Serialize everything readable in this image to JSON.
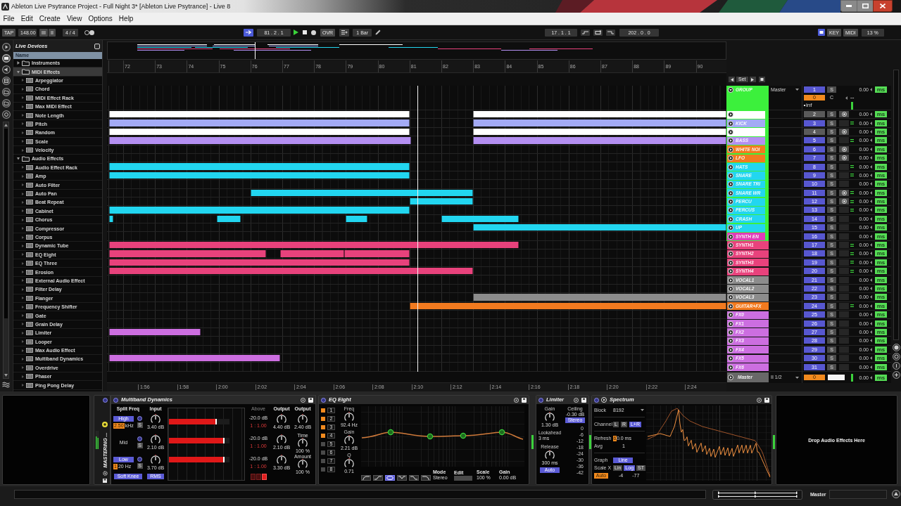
{
  "window": {
    "title": "Ableton Live Psytrance Project - Full Night 3*  [Ableton Live Psytrance] - Live 8"
  },
  "menu": [
    "File",
    "Edit",
    "Create",
    "View",
    "Options",
    "Help"
  ],
  "transport": {
    "tap": "TAP",
    "tempo": "148.00",
    "nudge_down": "III",
    "nudge_up": "II",
    "signature": "4 / 4",
    "follow": true,
    "position": "81 . 2 . 1",
    "playing": true,
    "recording": false,
    "overdub": "OVR",
    "quantize": "1 Bar",
    "loop_start": "17 . 1 . 1",
    "loop_length": "202 . 0 . 0",
    "key": "KEY",
    "midi": "MIDI",
    "cpu": "13 %"
  },
  "browser": {
    "title": "Live Devices",
    "column": "Name",
    "items": [
      {
        "label": "Instruments",
        "kind": "folder",
        "expanded": false,
        "selected": false
      },
      {
        "label": "MIDI Effects",
        "kind": "folder",
        "expanded": true,
        "selected": true,
        "children": [
          {
            "label": "Arpeggiator",
            "kind": "device",
            "selected": false
          },
          {
            "label": "Chord",
            "kind": "device",
            "selected": false
          },
          {
            "label": "MIDI Effect Rack",
            "kind": "device",
            "selected": false
          },
          {
            "label": "Max MIDI Effect",
            "kind": "device",
            "selected": false
          },
          {
            "label": "Note Length",
            "kind": "device",
            "selected": false
          },
          {
            "label": "Pitch",
            "kind": "device",
            "selected": false
          },
          {
            "label": "Random",
            "kind": "device",
            "selected": false
          },
          {
            "label": "Scale",
            "kind": "device",
            "selected": false
          },
          {
            "label": "Velocity",
            "kind": "device",
            "selected": false
          }
        ]
      },
      {
        "label": "Audio Effects",
        "kind": "folder",
        "expanded": true,
        "selected": false,
        "children": [
          {
            "label": "Audio Effect Rack",
            "kind": "device",
            "selected": false
          },
          {
            "label": "Amp",
            "kind": "device",
            "selected": false
          },
          {
            "label": "Auto Filter",
            "kind": "device",
            "selected": false
          },
          {
            "label": "Auto Pan",
            "kind": "device",
            "selected": false
          },
          {
            "label": "Beat Repeat",
            "kind": "device",
            "selected": false
          },
          {
            "label": "Cabinet",
            "kind": "device",
            "selected": false
          },
          {
            "label": "Chorus",
            "kind": "device",
            "selected": false
          },
          {
            "label": "Compressor",
            "kind": "device",
            "selected": false
          },
          {
            "label": "Corpus",
            "kind": "device",
            "selected": false
          },
          {
            "label": "Dynamic Tube",
            "kind": "device",
            "selected": false
          },
          {
            "label": "EQ Eight",
            "kind": "device",
            "selected": false
          },
          {
            "label": "EQ Three",
            "kind": "device",
            "selected": false
          },
          {
            "label": "Erosion",
            "kind": "device",
            "selected": false
          },
          {
            "label": "External Audio Effect",
            "kind": "device",
            "selected": false
          },
          {
            "label": "Filter Delay",
            "kind": "device",
            "selected": false
          },
          {
            "label": "Flanger",
            "kind": "device",
            "selected": false
          },
          {
            "label": "Frequency Shifter",
            "kind": "device",
            "selected": false
          },
          {
            "label": "Gate",
            "kind": "device",
            "selected": false
          },
          {
            "label": "Grain Delay",
            "kind": "device",
            "selected": false
          },
          {
            "label": "Limiter",
            "kind": "device",
            "selected": false
          },
          {
            "label": "Looper",
            "kind": "device",
            "selected": false
          },
          {
            "label": "Max Audio Effect",
            "kind": "device",
            "selected": false
          },
          {
            "label": "Multiband Dynamics",
            "kind": "device",
            "selected": false
          },
          {
            "label": "Overdrive",
            "kind": "device",
            "selected": false
          },
          {
            "label": "Phaser",
            "kind": "device",
            "selected": false
          },
          {
            "label": "Ping Pong Delay",
            "kind": "device",
            "selected": false
          }
        ]
      }
    ]
  },
  "arrangement": {
    "bars": [
      "72",
      "73",
      "74",
      "75",
      "76",
      "77",
      "78",
      "79",
      "80",
      "81",
      "82",
      "83",
      "84",
      "85",
      "86",
      "87",
      "88",
      "89",
      "90"
    ],
    "times": [
      "1:56",
      "1:58",
      "2:00",
      "2:02",
      "2:04",
      "2:06",
      "2:08",
      "2:10",
      "2:12",
      "2:14",
      "2:16",
      "2:18",
      "2:20",
      "2:22",
      "2:24"
    ],
    "playhead": {
      "level": 0.5013
    },
    "set": "Set"
  },
  "tracks": [
    {
      "name": "GROUP",
      "color": "#3cf03c",
      "expanded": true,
      "output": "Master",
      "number": "1",
      "active": true,
      "solo": "S",
      "volume": "0",
      "pan": "C",
      "send": "--",
      "peak": "inf",
      "delay": "0.00",
      "delay_unit": "ms",
      "children": [
        {
          "color": "#ffffff",
          "number": "2",
          "active": false,
          "solo": "S",
          "armed": true,
          "signal": false,
          "delay": "0.00",
          "delay_unit": "ms",
          "clips": [
            {
              "start": {
                "level": 0.0034
              },
              "end": {
                "level": 0.4884
              }
            },
            {
              "start": {
                "level": 0.5911
              },
              "end": {
                "level": 1
              }
            }
          ]
        },
        {
          "name": "KICK",
          "color": "#a3aaf5",
          "number": "3",
          "active": true,
          "solo": "S",
          "armed": false,
          "signal": true,
          "delay": "0.00",
          "delay_unit": "ms",
          "clips": [
            {
              "start": {
                "level": 0.0034
              },
              "end": {
                "level": 0.4884
              }
            },
            {
              "start": {
                "level": 0.5911
              },
              "end": {
                "level": 1
              }
            }
          ]
        },
        {
          "color": "#ffffff",
          "number": "4",
          "active": false,
          "solo": "S",
          "armed": true,
          "signal": false,
          "delay": "0.00",
          "delay_unit": "ms",
          "clips": [
            {
              "start": {
                "level": 0.0034
              },
              "end": {
                "level": 0.4884
              }
            },
            {
              "start": {
                "level": 0.5911
              },
              "end": {
                "level": 1
              }
            }
          ]
        },
        {
          "name": "BASS",
          "color": "#b48ff2",
          "number": "5",
          "active": true,
          "solo": "S",
          "armed": false,
          "signal": true,
          "delay": "0.00",
          "delay_unit": "ms",
          "clips": [
            {
              "start": {
                "level": 0.0034
              },
              "end": {
                "level": 0.4907
              }
            },
            {
              "start": {
                "level": 0.5911
              },
              "end": {
                "level": 1
              }
            }
          ]
        },
        {
          "name": "WHITE NOI",
          "color": "#f27a1f",
          "number": "6",
          "active": true,
          "solo": "S",
          "armed": true,
          "signal": false,
          "delay": "0.00",
          "delay_unit": "ms"
        },
        {
          "name": "LFO",
          "color": "#f27a1f",
          "number": "7",
          "active": true,
          "solo": "S",
          "armed": true,
          "signal": false,
          "delay": "0.00",
          "delay_unit": "ms"
        },
        {
          "name": "HATS",
          "color": "#22d6f0",
          "number": "8",
          "active": true,
          "solo": "S",
          "armed": false,
          "signal": true,
          "delay": "0.00",
          "delay_unit": "ms",
          "clips": [
            {
              "start": {
                "level": 0.0034
              },
              "end": {
                "level": 0.4884
              }
            }
          ]
        },
        {
          "name": "SNARE",
          "color": "#22d6f0",
          "number": "9",
          "active": true,
          "solo": "S",
          "armed": false,
          "signal": true,
          "delay": "0.00",
          "delay_unit": "ms",
          "clips": [
            {
              "start": {
                "level": 0.0034
              },
              "end": {
                "level": 0.4884
              }
            }
          ]
        },
        {
          "name": "SNARE TRI",
          "color": "#22d6f0",
          "number": "10",
          "active": true,
          "solo": "S",
          "armed": false,
          "signal": false,
          "delay": "0.00",
          "delay_unit": "ms"
        },
        {
          "name": "SNARE WR",
          "color": "#22d6f0",
          "number": "11",
          "active": true,
          "solo": "S",
          "armed": true,
          "signal": true,
          "delay": "0.00",
          "delay_unit": "ms",
          "clips": [
            {
              "start": {
                "level": 0.2316
              },
              "end": {
                "level": 0.5911
              }
            }
          ]
        },
        {
          "name": "PERCU",
          "color": "#22d6f0",
          "number": "12",
          "active": true,
          "solo": "S",
          "armed": true,
          "signal": true,
          "delay": "0.00",
          "delay_unit": "ms",
          "clips": [
            {
              "start": {
                "level": 0.4884
              },
              "end": {
                "level": 0.5911
              }
            }
          ]
        },
        {
          "name": "PERCUS",
          "color": "#22d6f0",
          "number": "13",
          "active": true,
          "solo": "S",
          "armed": false,
          "signal": true,
          "delay": "0.00",
          "delay_unit": "ms",
          "clips": [
            {
              "start": {
                "level": 0.0034
              },
              "end": {
                "level": 0.4884
              }
            }
          ]
        },
        {
          "name": "CRASH",
          "color": "#22d6f0",
          "number": "14",
          "active": true,
          "solo": "S",
          "armed": false,
          "signal": false,
          "delay": "0.00",
          "delay_unit": "ms",
          "clips": [
            {
              "start": {
                "level": 0.0034
              },
              "end": {
                "level": 0.0101
              }
            },
            {
              "start": {
                "level": 0.177
              },
              "end": {
                "level": 0.2156
              }
            },
            {
              "start": {
                "level": 0.3857
              },
              "end": {
                "level": 0.421
              }
            },
            {
              "start": {
                "level": 0.5398
              },
              "end": {
                "level": 0.665
              }
            }
          ]
        },
        {
          "name": "UP",
          "color": "#22d6f0",
          "number": "15",
          "active": true,
          "solo": "S",
          "armed": false,
          "signal": false,
          "delay": "0.00",
          "delay_unit": "ms",
          "clips": [
            {
              "start": {
                "level": 0.5911
              },
              "end": {
                "level": 1
              }
            }
          ]
        },
        {
          "name": "SYNTH EN",
          "color": "#e03cb8",
          "number": "16",
          "active": true,
          "solo": "S",
          "armed": false,
          "signal": false,
          "delay": "0.00",
          "delay_unit": "ms"
        }
      ]
    },
    {
      "name": "SYNTH1",
      "color": "#e8427c",
      "number": "17",
      "active": true,
      "solo": "S",
      "armed": false,
      "signal": true,
      "delay": "0.00",
      "delay_unit": "ms",
      "clips": [
        {
          "start": {
            "level": 0.0034
          },
          "end": {
            "level": 0.665
          }
        }
      ]
    },
    {
      "name": "SYNTH2",
      "color": "#e8427c",
      "number": "18",
      "active": true,
      "solo": "S",
      "armed": false,
      "signal": true,
      "delay": "0.00",
      "delay_unit": "ms",
      "clips": [
        {
          "start": {
            "level": 0.0034
          },
          "end": {
            "level": 0.2573
          }
        },
        {
          "start": {
            "level": 0.2798
          },
          "end": {
            "level": 0.3825
          }
        },
        {
          "start": {
            "level": 0.3825
          },
          "end": {
            "level": 0.4884
          }
        }
      ]
    },
    {
      "name": "SYNTH3",
      "color": "#e8427c",
      "number": "19",
      "active": true,
      "solo": "S",
      "armed": false,
      "signal": true,
      "delay": "0.00",
      "delay_unit": "ms",
      "clips": [
        {
          "start": {
            "level": 0.0034
          },
          "end": {
            "level": 0.4884
          }
        }
      ]
    },
    {
      "name": "SYNTH4",
      "color": "#e8427c",
      "number": "20",
      "active": true,
      "solo": "S",
      "armed": false,
      "signal": true,
      "delay": "0.00",
      "delay_unit": "ms",
      "clips": [
        {
          "start": {
            "level": 0.0034
          },
          "end": {
            "level": 0.5911
          }
        }
      ]
    },
    {
      "name": "VOCAL1",
      "color": "#8c8c8c",
      "number": "21",
      "active": true,
      "solo": "S",
      "armed": false,
      "signal": false,
      "delay": "0.00",
      "delay_unit": "ms"
    },
    {
      "name": "VOCAL2",
      "color": "#8c8c8c",
      "number": "22",
      "active": true,
      "solo": "S",
      "armed": false,
      "signal": false,
      "delay": "0.00",
      "delay_unit": "ms"
    },
    {
      "name": "VOCAL3",
      "color": "#8c8c8c",
      "number": "23",
      "active": true,
      "solo": "S",
      "armed": false,
      "signal": false,
      "delay": "0.00",
      "delay_unit": "ms",
      "clips": [
        {
          "start": {
            "level": 0.5911
          },
          "end": {
            "level": 1
          }
        }
      ]
    },
    {
      "name": "GUITAR+FX",
      "color": "#f27a1f",
      "number": "24",
      "active": true,
      "solo": "S",
      "armed": false,
      "signal": true,
      "delay": "0.00",
      "delay_unit": "ms",
      "clips": [
        {
          "start": {
            "level": 0.4884
          },
          "end": {
            "level": 1
          }
        }
      ]
    },
    {
      "name": "FX0",
      "color": "#cc6ee0",
      "number": "25",
      "active": true,
      "solo": "S",
      "armed": false,
      "signal": false,
      "delay": "0.00",
      "delay_unit": "ms"
    },
    {
      "name": "FX1",
      "color": "#cc6ee0",
      "number": "26",
      "active": true,
      "solo": "S",
      "armed": false,
      "signal": false,
      "delay": "0.00",
      "delay_unit": "ms"
    },
    {
      "name": "FX2",
      "color": "#cc6ee0",
      "number": "27",
      "active": true,
      "solo": "S",
      "armed": false,
      "signal": false,
      "delay": "0.00",
      "delay_unit": "ms",
      "clips": [
        {
          "start": {
            "level": 0.0034
          },
          "end": {
            "level": 0.1514
          }
        }
      ]
    },
    {
      "name": "FX3",
      "color": "#cc6ee0",
      "number": "28",
      "active": true,
      "solo": "S",
      "armed": false,
      "signal": false,
      "delay": "0.00",
      "delay_unit": "ms"
    },
    {
      "name": "FX4",
      "color": "#cc6ee0",
      "number": "29",
      "active": true,
      "solo": "S",
      "armed": false,
      "signal": false,
      "delay": "0.00",
      "delay_unit": "ms"
    },
    {
      "name": "FX5",
      "color": "#cc6ee0",
      "number": "30",
      "active": true,
      "solo": "S",
      "armed": false,
      "signal": false,
      "delay": "0.00",
      "delay_unit": "ms",
      "clips": [
        {
          "start": {
            "level": 0.0034
          },
          "end": {
            "level": 0.2798
          }
        }
      ]
    },
    {
      "name": "FX6",
      "color": "#cc6ee0",
      "number": "31",
      "active": true,
      "solo": "S",
      "armed": false,
      "signal": false,
      "delay": "0.00",
      "delay_unit": "ms"
    }
  ],
  "master": {
    "name": "Master",
    "input": "II 1/2",
    "volume": "0",
    "delay": "0.00",
    "delay_unit": "ms"
  },
  "device_chain": {
    "rack": "MASTERING ...",
    "drop_hint": "Drop Audio Effects Here",
    "devices": [
      {
        "kind": "multiband",
        "title": "Multiband Dynamics",
        "split_label": "Split Freq",
        "input_label": "Input",
        "above_label": "Above",
        "output_label": "Output",
        "bands": [
          {
            "kind": "switch",
            "name": "High",
            "solo": "S",
            "freq_selected": "2.50",
            "freq_rest": "kHz",
            "input": "3.40 dB",
            "level": 0.79,
            "above": "-20.0 dB",
            "ratio": "1 : 1.00",
            "output": "4.40 dB"
          },
          {
            "kind": "label",
            "name": "Mid",
            "solo": "S",
            "input": "2.10 dB",
            "level": 0.92,
            "above": "-20.0 dB",
            "ratio": "1 : 1.00",
            "output": "2.10 dB"
          },
          {
            "kind": "switch",
            "name": "Low",
            "solo": "S",
            "freq_selected": "1",
            "freq_rest": "20 Hz",
            "input": "3.70 dB",
            "level": 0.92,
            "above": "-20.0 dB",
            "ratio": "1 : 1.00",
            "output": "3.30 dB"
          }
        ],
        "mode_switch": [
          {
            "selected": false
          },
          {
            "selected": false
          },
          {
            "selected": true
          }
        ],
        "master_output_label": "Output",
        "master_output": "2.40 dB",
        "time_label": "Time",
        "time": "100 %",
        "amount_label": "Amount",
        "amount": "100 %",
        "soft_knee": "Soft Knee",
        "rms": "RMS"
      },
      {
        "kind": "eq",
        "title": "EQ Eight",
        "bands": [
          {
            "label": "1",
            "on": true
          },
          {
            "label": "2",
            "on": true
          },
          {
            "label": "3",
            "on": true
          },
          {
            "label": "4",
            "on": true
          },
          {
            "label": "5",
            "on": false
          },
          {
            "label": "6",
            "on": false
          },
          {
            "label": "7",
            "on": false
          },
          {
            "label": "8",
            "on": false
          }
        ],
        "freq_label": "Freq",
        "freq": "92.4 Hz",
        "gain_label": "Gain",
        "gain": "2.21 dB",
        "q_label": "Q",
        "q": "0.71",
        "filters": [
          {
            "kind": "lowcut",
            "selected": false
          },
          {
            "kind": "lowshelf",
            "selected": false
          },
          {
            "kind": "bell",
            "selected": true
          },
          {
            "kind": "notch",
            "selected": false
          },
          {
            "kind": "highshelf",
            "selected": false
          },
          {
            "kind": "highcut",
            "selected": false
          }
        ],
        "mode_label": "Mode",
        "mode": "Stereo",
        "edit_label": "Edit",
        "scale_label": "Scale",
        "scale": "100 %",
        "output_gain_label": "Gain",
        "output_gain": "0.00 dB"
      },
      {
        "kind": "limiter",
        "title": "Limiter",
        "gain_label": "Gain",
        "gain": "1.30 dB",
        "ceiling_label": "Ceiling",
        "ceiling": "-0.30 dB",
        "stereo": "Stereo",
        "lookahead_label": "Lookahead",
        "lookahead": "3 ms",
        "release_label": "Release",
        "release": "300 ms",
        "auto": "Auto",
        "scale": [
          "0",
          "-6",
          "-12",
          "-18",
          "-24",
          "-30",
          "-36",
          "-42"
        ]
      },
      {
        "kind": "spectrum",
        "title": "Spectrum",
        "block_label": "Block",
        "block": "8192",
        "channel_label": "Channel",
        "channels": [
          {
            "label": "L",
            "selected": false
          },
          {
            "label": "R",
            "selected": false
          },
          {
            "label": "L+R",
            "selected": true
          }
        ],
        "refresh_label": "Refresh",
        "refresh_selected": "6",
        "refresh_rest": "0.0 ms",
        "avg_label": "Avg",
        "avg": "1",
        "graph_label": "Graph",
        "graph": "Line",
        "scale_label": "Scale X",
        "scales": [
          {
            "label": "Lin",
            "selected": false
          },
          {
            "label": "Log",
            "selected": true
          },
          {
            "label": "ST",
            "selected": false
          }
        ],
        "auto": "Auto",
        "range_max": "-4",
        "range_min": "-77"
      }
    ]
  },
  "status_bar": {
    "track": "Master"
  }
}
